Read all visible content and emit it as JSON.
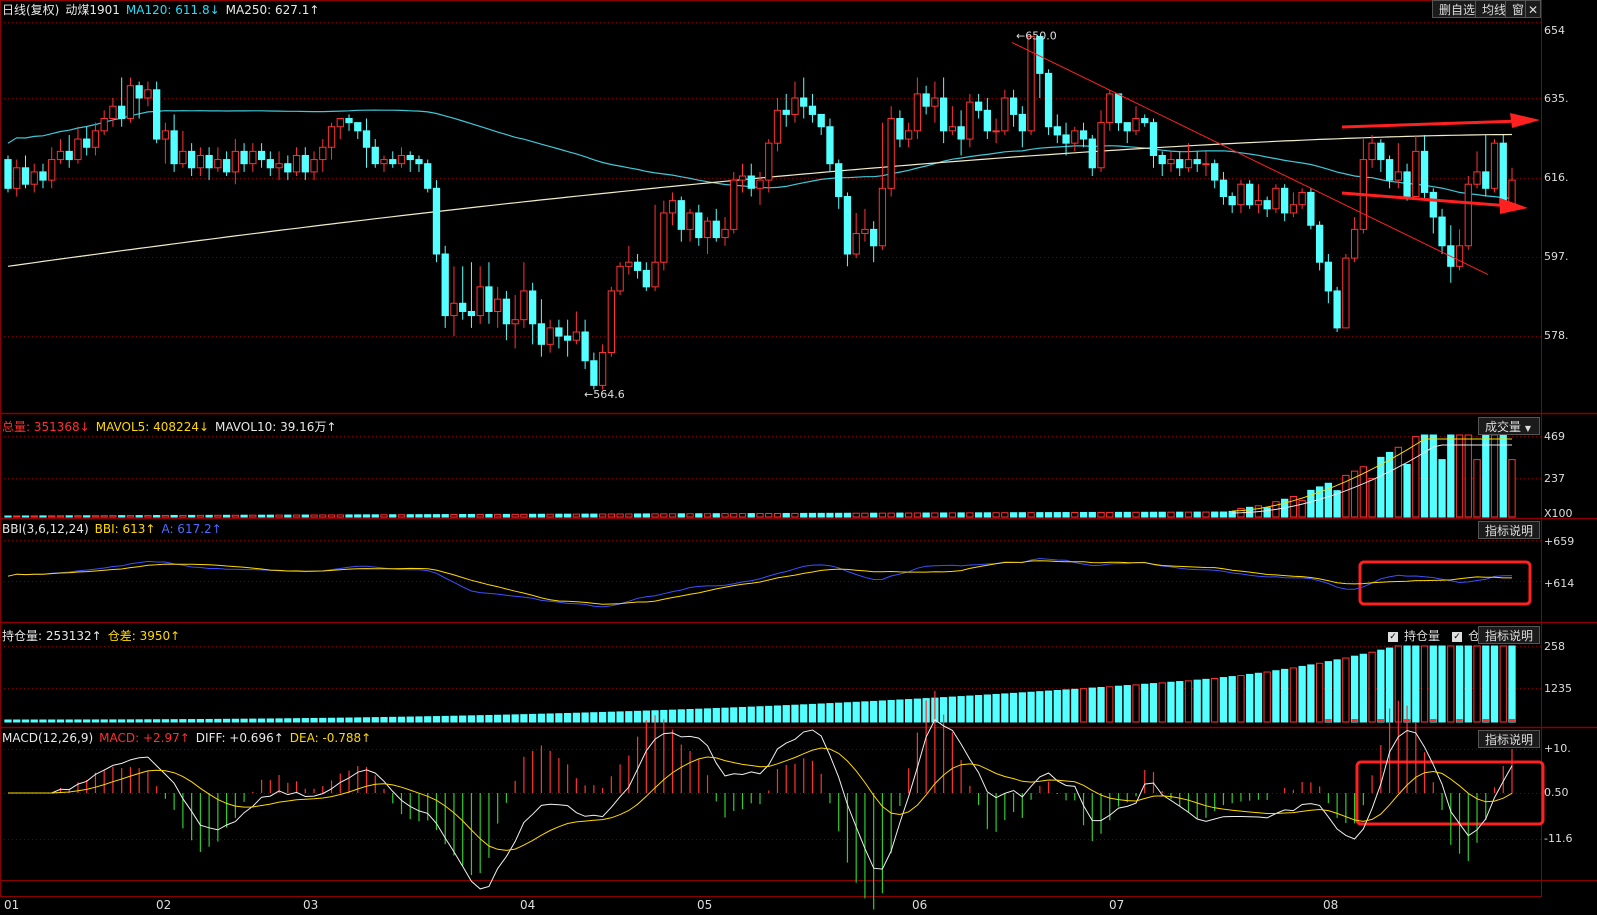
{
  "title_bar": {
    "period": "日线(复权)",
    "symbol": "动煤1901",
    "ma120_label": "MA120: 611.8↓",
    "ma250_label": "MA250: 627.1↑"
  },
  "toolbar": {
    "delete_watch": "删自选",
    "avg_line": "均线",
    "window": "窗"
  },
  "volume_header": {
    "total": "总量: 351368↓",
    "mavol5": "MAVOL5: 408224↓",
    "mavol10": "MAVOL10: 39.16万↑",
    "dropdown": "成交量"
  },
  "bbi_header": {
    "name": "BBI(3,6,12,24)",
    "bbi": "BBI: 613↑",
    "a": "A: 617.2↑",
    "explain": "指标说明"
  },
  "oi_header": {
    "oi": "持仓量: 253132↑",
    "diff": "仓差: 3950↑",
    "chk_oi": "持仓量",
    "chk_diff": "仓差",
    "explain": "指标说明"
  },
  "macd_header": {
    "name": "MACD(12,26,9)",
    "macd": "MACD: +2.97↑",
    "diff": "DIFF: +0.696↑",
    "dea": "DEA: -0.788↑",
    "explain": "指标说明"
  },
  "price_axis": [
    "654",
    "635.",
    "616.",
    "597.",
    "578."
  ],
  "volume_axis": [
    "469",
    "237",
    "X100"
  ],
  "bbi_axis": [
    "+659",
    "+614"
  ],
  "oi_axis": [
    "258",
    "1235"
  ],
  "macd_axis": [
    "+10.",
    "0.50",
    "-11.6"
  ],
  "x_axis": [
    "01",
    "02",
    "03",
    "04",
    "05",
    "06",
    "07",
    "08"
  ],
  "annotations": {
    "high_label": "650.0",
    "low_label": "564.6"
  },
  "colors": {
    "up": "#ff3232",
    "down": "#54ffff",
    "ma120": "#3ec8d8",
    "ma250": "#f0ecc8",
    "grid": "#8b0000",
    "trend": "#ff2020"
  },
  "chart_data": {
    "type": "candlestick",
    "instrument": "动煤1901",
    "price_range": [
      560,
      655
    ],
    "candles": [
      [
        621,
        614,
        622,
        613
      ],
      [
        614,
        619,
        621,
        612
      ],
      [
        619,
        615,
        622,
        614
      ],
      [
        615,
        618,
        620,
        613
      ],
      [
        618,
        616,
        620,
        614
      ],
      [
        616,
        621,
        624,
        614
      ],
      [
        621,
        623,
        626,
        620
      ],
      [
        623,
        621,
        627,
        619
      ],
      [
        621,
        626,
        629,
        620
      ],
      [
        626,
        624,
        629,
        622
      ],
      [
        624,
        628,
        630,
        622
      ],
      [
        628,
        631,
        633,
        627
      ],
      [
        631,
        634,
        636,
        629
      ],
      [
        634,
        631,
        641,
        629
      ],
      [
        631,
        639,
        641,
        630
      ],
      [
        639,
        636,
        640,
        631
      ],
      [
        636,
        638,
        640,
        634
      ],
      [
        638,
        626,
        640,
        625
      ],
      [
        626,
        628,
        630,
        620
      ],
      [
        628,
        620,
        632,
        618
      ],
      [
        620,
        623,
        628,
        619
      ],
      [
        623,
        619,
        625,
        617
      ],
      [
        619,
        622,
        624,
        617
      ],
      [
        622,
        619,
        624,
        616
      ],
      [
        619,
        621,
        624,
        618
      ],
      [
        621,
        618,
        623,
        617
      ],
      [
        618,
        623,
        626,
        615
      ],
      [
        623,
        620,
        625,
        618
      ],
      [
        620,
        623,
        625,
        618
      ],
      [
        623,
        621,
        625,
        619
      ],
      [
        621,
        619,
        623,
        617
      ],
      [
        619,
        620,
        623,
        616
      ],
      [
        620,
        618,
        622,
        616
      ],
      [
        618,
        622,
        624,
        617
      ],
      [
        622,
        618,
        624,
        616
      ],
      [
        618,
        621,
        623,
        616
      ],
      [
        621,
        624,
        626,
        618
      ],
      [
        624,
        629,
        630,
        621
      ],
      [
        629,
        631,
        631,
        626
      ],
      [
        631,
        630,
        632,
        628
      ],
      [
        630,
        628,
        630,
        626
      ],
      [
        628,
        624,
        631,
        619
      ],
      [
        624,
        620,
        626,
        619
      ],
      [
        620,
        621,
        622,
        618
      ],
      [
        621,
        620,
        623,
        619
      ],
      [
        620,
        622,
        624,
        619
      ],
      [
        622,
        621,
        623,
        618
      ],
      [
        621,
        620,
        622,
        618
      ],
      [
        620,
        614,
        621,
        613
      ],
      [
        614,
        598,
        616,
        596
      ],
      [
        598,
        583,
        600,
        580
      ],
      [
        583,
        586,
        595,
        578
      ],
      [
        586,
        584,
        595,
        582
      ],
      [
        584,
        583,
        596,
        580
      ],
      [
        583,
        590,
        595,
        581
      ],
      [
        590,
        584,
        596,
        581
      ],
      [
        584,
        587,
        590,
        580
      ],
      [
        587,
        581,
        589,
        577
      ],
      [
        581,
        582,
        588,
        575
      ],
      [
        582,
        589,
        596,
        580
      ],
      [
        589,
        581,
        591,
        576
      ],
      [
        581,
        576,
        587,
        573
      ],
      [
        576,
        580,
        582,
        574
      ],
      [
        580,
        578,
        582,
        575
      ],
      [
        578,
        577,
        582,
        573
      ],
      [
        577,
        579,
        584,
        576
      ],
      [
        579,
        572,
        582,
        570
      ],
      [
        572,
        566,
        574,
        565
      ],
      [
        566,
        574,
        576,
        565
      ],
      [
        574,
        589,
        590,
        573
      ],
      [
        589,
        595,
        596,
        588
      ],
      [
        595,
        596,
        600,
        593
      ],
      [
        596,
        594,
        598,
        592
      ],
      [
        594,
        590,
        596,
        589
      ],
      [
        590,
        596,
        610,
        589
      ],
      [
        596,
        608,
        611,
        594
      ],
      [
        608,
        611,
        613,
        605
      ],
      [
        611,
        604,
        612,
        601
      ],
      [
        604,
        608,
        609,
        601
      ],
      [
        608,
        602,
        610,
        600
      ],
      [
        602,
        606,
        607,
        598
      ],
      [
        606,
        602,
        609,
        601
      ],
      [
        602,
        604,
        607,
        600
      ],
      [
        604,
        616,
        618,
        603
      ],
      [
        616,
        617,
        620,
        613
      ],
      [
        617,
        614,
        620,
        612
      ],
      [
        614,
        616,
        618,
        610
      ],
      [
        616,
        625,
        626,
        613
      ],
      [
        625,
        633,
        636,
        623
      ],
      [
        633,
        632,
        637,
        629
      ],
      [
        632,
        636,
        640,
        630
      ],
      [
        636,
        634,
        641,
        631
      ],
      [
        634,
        632,
        637,
        630
      ],
      [
        632,
        629,
        632,
        627
      ],
      [
        629,
        620,
        631,
        618
      ],
      [
        620,
        612,
        621,
        609
      ],
      [
        612,
        598,
        613,
        595
      ],
      [
        598,
        603,
        608,
        597
      ],
      [
        603,
        604,
        609,
        601
      ],
      [
        604,
        600,
        606,
        596
      ],
      [
        600,
        614,
        630,
        599
      ],
      [
        614,
        631,
        634,
        612
      ],
      [
        631,
        626,
        633,
        624
      ],
      [
        626,
        628,
        630,
        624
      ],
      [
        628,
        637,
        641,
        626
      ],
      [
        637,
        634,
        639,
        632
      ],
      [
        634,
        636,
        640,
        630
      ],
      [
        636,
        628,
        641,
        625
      ],
      [
        628,
        629,
        634,
        627
      ],
      [
        629,
        626,
        633,
        622
      ],
      [
        626,
        635,
        637,
        624
      ],
      [
        635,
        633,
        637,
        631
      ],
      [
        633,
        628,
        636,
        626
      ],
      [
        628,
        628,
        631,
        625
      ],
      [
        628,
        636,
        638,
        627
      ],
      [
        636,
        632,
        638,
        629
      ],
      [
        632,
        628,
        634,
        624
      ],
      [
        628,
        651,
        651,
        627
      ],
      [
        651,
        642,
        650,
        636
      ],
      [
        642,
        629,
        643,
        627
      ],
      [
        629,
        627,
        632,
        625
      ],
      [
        627,
        625,
        630,
        622
      ],
      [
        625,
        628,
        629,
        623
      ],
      [
        628,
        626,
        630,
        624
      ],
      [
        626,
        619,
        627,
        617
      ],
      [
        619,
        630,
        633,
        618
      ],
      [
        630,
        637,
        638,
        628
      ],
      [
        637,
        630,
        634,
        628
      ],
      [
        630,
        628,
        630,
        625
      ],
      [
        628,
        631,
        634,
        627
      ],
      [
        631,
        630,
        632,
        629
      ],
      [
        630,
        622,
        631,
        619
      ],
      [
        622,
        620,
        623,
        617
      ],
      [
        620,
        621,
        623,
        618
      ],
      [
        621,
        619,
        623,
        617
      ],
      [
        619,
        621,
        625,
        618
      ],
      [
        621,
        620,
        623,
        618
      ],
      [
        620,
        620,
        623,
        617
      ],
      [
        620,
        616,
        621,
        614
      ],
      [
        616,
        612,
        618,
        610
      ],
      [
        612,
        610,
        613,
        608
      ],
      [
        610,
        615,
        616,
        608
      ],
      [
        615,
        610,
        616,
        609
      ],
      [
        610,
        611,
        615,
        608
      ],
      [
        611,
        609,
        612,
        607
      ],
      [
        609,
        614,
        615,
        608
      ],
      [
        614,
        608,
        615,
        606
      ],
      [
        608,
        610,
        613,
        607
      ],
      [
        610,
        613,
        614,
        609
      ],
      [
        613,
        605,
        614,
        604
      ],
      [
        605,
        596,
        606,
        594
      ],
      [
        596,
        589,
        598,
        586
      ],
      [
        589,
        580,
        590,
        579
      ],
      [
        580,
        597,
        598,
        580
      ],
      [
        597,
        604,
        607,
        596
      ],
      [
        604,
        621,
        626,
        603
      ],
      [
        621,
        625,
        627,
        619
      ],
      [
        625,
        621,
        626,
        618
      ],
      [
        621,
        616,
        622,
        614
      ],
      [
        616,
        618,
        625,
        614
      ],
      [
        618,
        612,
        620,
        611
      ],
      [
        612,
        623,
        627,
        612
      ],
      [
        623,
        613,
        627,
        611
      ],
      [
        613,
        607,
        614,
        603
      ],
      [
        607,
        600,
        609,
        598
      ],
      [
        600,
        595,
        605,
        591
      ],
      [
        595,
        600,
        604,
        594
      ],
      [
        600,
        615,
        617,
        599
      ],
      [
        615,
        618,
        623,
        614
      ],
      [
        618,
        614,
        627,
        612
      ],
      [
        614,
        625,
        626,
        613
      ],
      [
        625,
        610,
        627,
        610
      ],
      [
        610,
        616,
        619,
        609
      ]
    ],
    "ma120_start": 634,
    "ma120_end": 611.8,
    "ma250_start": 595,
    "ma250_end": 627.1,
    "high": 650.0,
    "low": 564.6
  }
}
